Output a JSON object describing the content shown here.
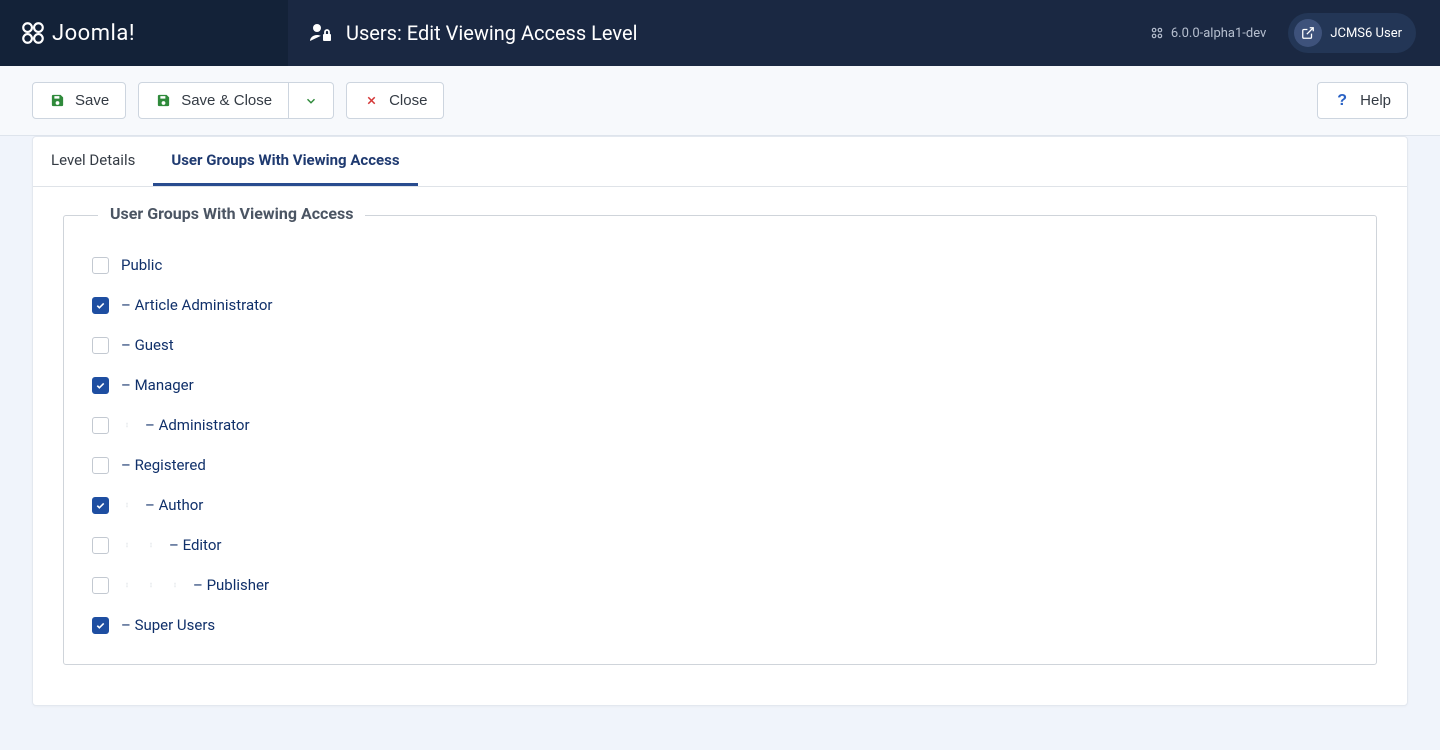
{
  "brand": "Joomla!",
  "header": {
    "title": "Users: Edit Viewing Access Level",
    "version": "6.0.0-alpha1-dev",
    "user": "JCMS6 User"
  },
  "toolbar": {
    "save": "Save",
    "save_close": "Save & Close",
    "close": "Close",
    "help": "Help"
  },
  "tabs": [
    {
      "label": "Level Details",
      "active": false
    },
    {
      "label": "User Groups With Viewing Access",
      "active": true
    }
  ],
  "fieldset_legend": "User Groups With Viewing Access",
  "groups": [
    {
      "label": "Public",
      "checked": false,
      "depth": 0
    },
    {
      "label": "– Article Administrator",
      "checked": true,
      "depth": 0
    },
    {
      "label": "– Guest",
      "checked": false,
      "depth": 0
    },
    {
      "label": "– Manager",
      "checked": true,
      "depth": 0
    },
    {
      "label": "– Administrator",
      "checked": false,
      "depth": 1
    },
    {
      "label": "– Registered",
      "checked": false,
      "depth": 0
    },
    {
      "label": "– Author",
      "checked": true,
      "depth": 1
    },
    {
      "label": "– Editor",
      "checked": false,
      "depth": 2
    },
    {
      "label": "– Publisher",
      "checked": false,
      "depth": 3
    },
    {
      "label": "– Super Users",
      "checked": true,
      "depth": 0
    }
  ]
}
